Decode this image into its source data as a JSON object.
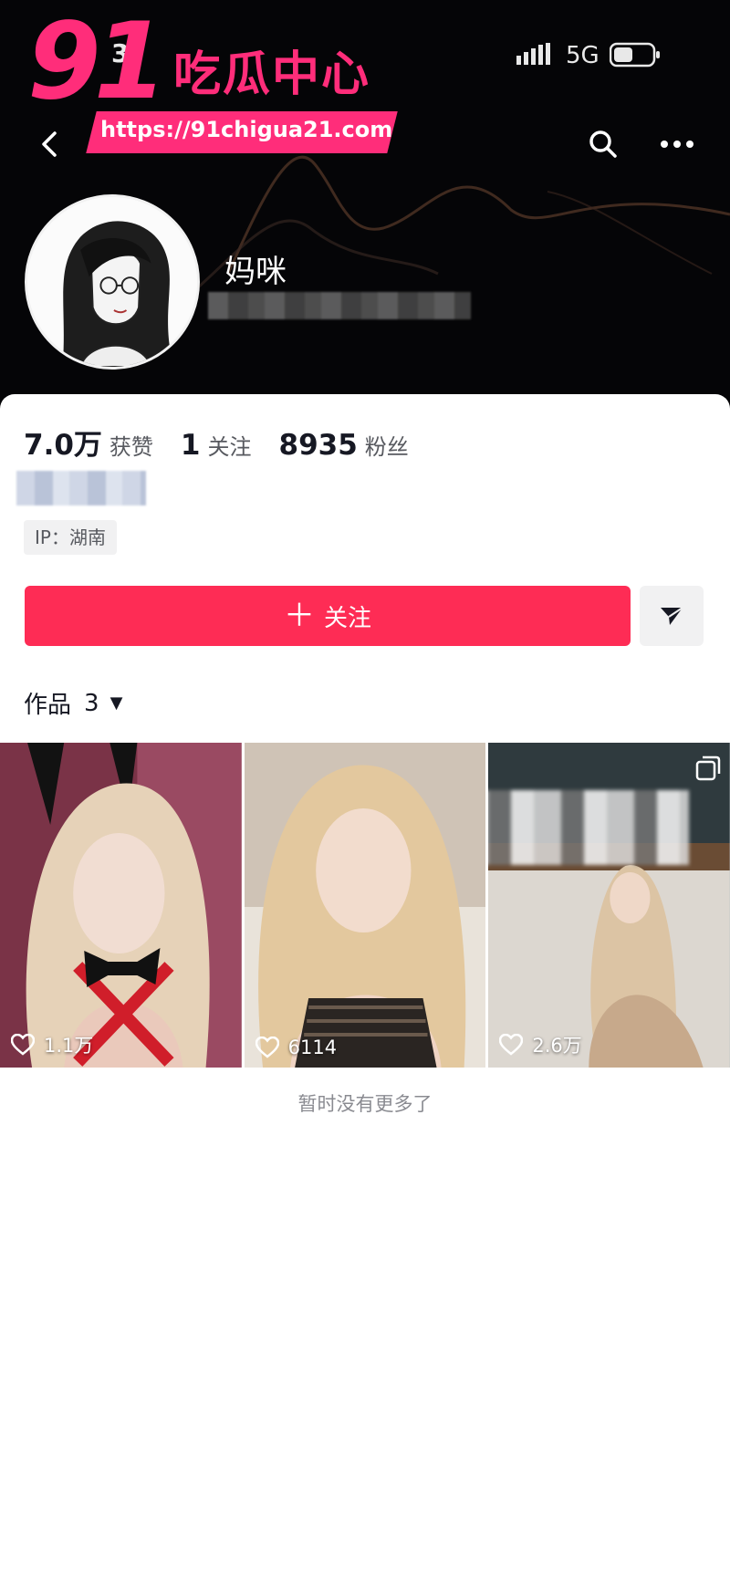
{
  "status_bar": {
    "time": "3:",
    "network": "5G"
  },
  "watermark": {
    "number": "91",
    "brand": "吃瓜中心",
    "url": "https://91chigua21.com"
  },
  "profile": {
    "nickname": "妈咪",
    "ip_location": "IP：湖南"
  },
  "stats": [
    {
      "value": "7.0万",
      "label": "获赞"
    },
    {
      "value": "1",
      "label": "关注"
    },
    {
      "value": "8935",
      "label": "粉丝"
    }
  ],
  "actions": {
    "follow_label": "关注",
    "follow_prefix": "＋"
  },
  "works": {
    "tab_label": "作品",
    "count": "3",
    "items": [
      {
        "likes": "1.1万"
      },
      {
        "likes": "6114"
      },
      {
        "likes": "2.6万"
      }
    ],
    "end_text": "暂时没有更多了"
  },
  "colors": {
    "accent": "#fe2c55",
    "watermark": "#ff2d7a",
    "header_bg": "#050507"
  }
}
